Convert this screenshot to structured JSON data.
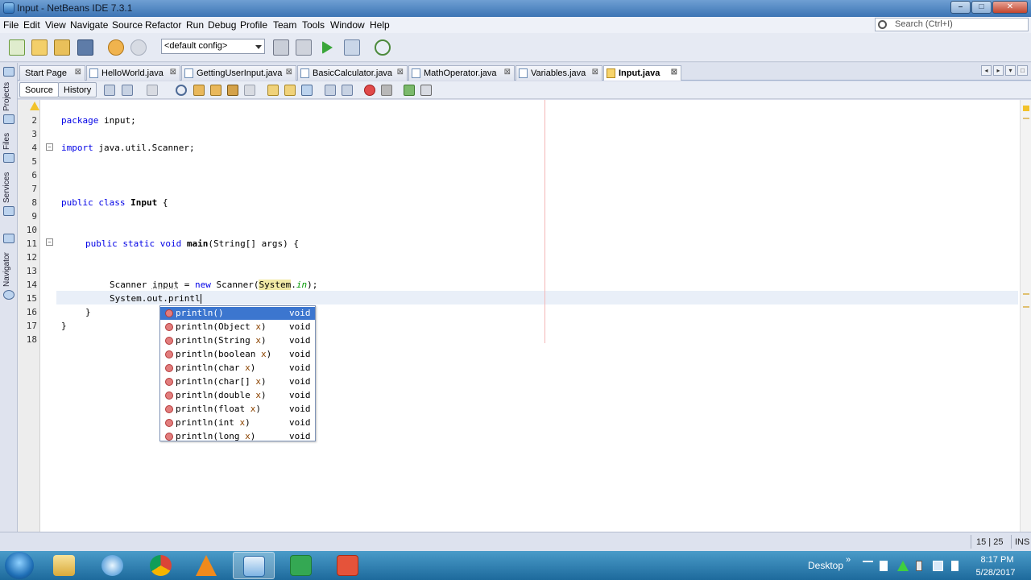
{
  "window": {
    "title": "Input - NetBeans IDE 7.3.1",
    "min_glyph": "–",
    "max_glyph": "□",
    "close_glyph": "✕"
  },
  "menu": [
    "File",
    "Edit",
    "View",
    "Navigate",
    "Source",
    "Refactor",
    "Run",
    "Debug",
    "Profile",
    "Team",
    "Tools",
    "Window",
    "Help"
  ],
  "search": {
    "placeholder": "Search (Ctrl+I)"
  },
  "toolbar": {
    "config": "<default config>"
  },
  "side_panels": [
    "Projects",
    "Files",
    "Services",
    "Navigator"
  ],
  "tabs": [
    {
      "label": "Start Page",
      "close": "⊠",
      "active": false
    },
    {
      "label": "HelloWorld.java",
      "close": "⊠",
      "active": false
    },
    {
      "label": "GettingUserInput.java",
      "close": "⊠",
      "active": false
    },
    {
      "label": "BasicCalculator.java",
      "close": "⊠",
      "active": false
    },
    {
      "label": "MathOperator.java",
      "close": "⊠",
      "active": false
    },
    {
      "label": "Variables.java",
      "close": "⊠",
      "active": false
    },
    {
      "label": "Input.java",
      "close": "⊠",
      "active": true
    }
  ],
  "tab_controls": [
    "◂",
    "▸",
    "▾",
    "□"
  ],
  "editor_tabs": {
    "source": "Source",
    "history": "History"
  },
  "line_numbers": [
    "2",
    "3",
    "4",
    "5",
    "6",
    "7",
    "8",
    "9",
    "10",
    "11",
    "12",
    "13",
    "14",
    "15",
    "16",
    "17",
    "18"
  ],
  "fold_glyph": "−",
  "code": {
    "l2": {
      "kw": "package",
      "rest": " input;"
    },
    "l4": {
      "kw": "import",
      "rest": " java.util.Scanner;"
    },
    "l8": {
      "kw1": "public",
      "kw2": "class",
      "name": "Input",
      "rest": " {"
    },
    "l11": {
      "kw1": "public",
      "kw2": "static",
      "kw3": "void",
      "name": "main",
      "rest": "(String[] args) {"
    },
    "l14": {
      "a": "Scanner ",
      "b": "input",
      "c": " = ",
      "kw": "new",
      "d": " Scanner(",
      "e": "System",
      "f": ".",
      "g": "in",
      "h": ");"
    },
    "l15": {
      "text": "System.out.printl"
    },
    "l16": {
      "text": "}"
    },
    "l17": {
      "text": "}"
    }
  },
  "completion": [
    {
      "name": "println",
      "params": "()",
      "pname": "",
      "ret": "void",
      "selected": true
    },
    {
      "name": "println",
      "params": "(Object ",
      "pname": "x",
      "close": ")",
      "ret": "void"
    },
    {
      "name": "println",
      "params": "(String ",
      "pname": "x",
      "close": ")",
      "ret": "void"
    },
    {
      "name": "println",
      "params": "(boolean ",
      "pname": "x",
      "close": ")",
      "ret": "void"
    },
    {
      "name": "println",
      "params": "(char ",
      "pname": "x",
      "close": ")",
      "ret": "void"
    },
    {
      "name": "println",
      "params": "(char[] ",
      "pname": "x",
      "close": ")",
      "ret": "void"
    },
    {
      "name": "println",
      "params": "(double ",
      "pname": "x",
      "close": ")",
      "ret": "void"
    },
    {
      "name": "println",
      "params": "(float ",
      "pname": "x",
      "close": ")",
      "ret": "void"
    },
    {
      "name": "println",
      "params": "(int ",
      "pname": "x",
      "close": ")",
      "ret": "void"
    },
    {
      "name": "println",
      "params": "(long ",
      "pname": "x",
      "close": ")",
      "ret": "void"
    }
  ],
  "status": {
    "position": "15 | 25",
    "mode": "INS"
  },
  "taskbar": {
    "desktop_label": "Desktop",
    "chevron": "»",
    "time": "8:17 PM",
    "date": "5/28/2017"
  },
  "colors": {
    "keyword": "#0000e6",
    "selection": "#3c76cf",
    "title_bar": "#3c74b4"
  }
}
